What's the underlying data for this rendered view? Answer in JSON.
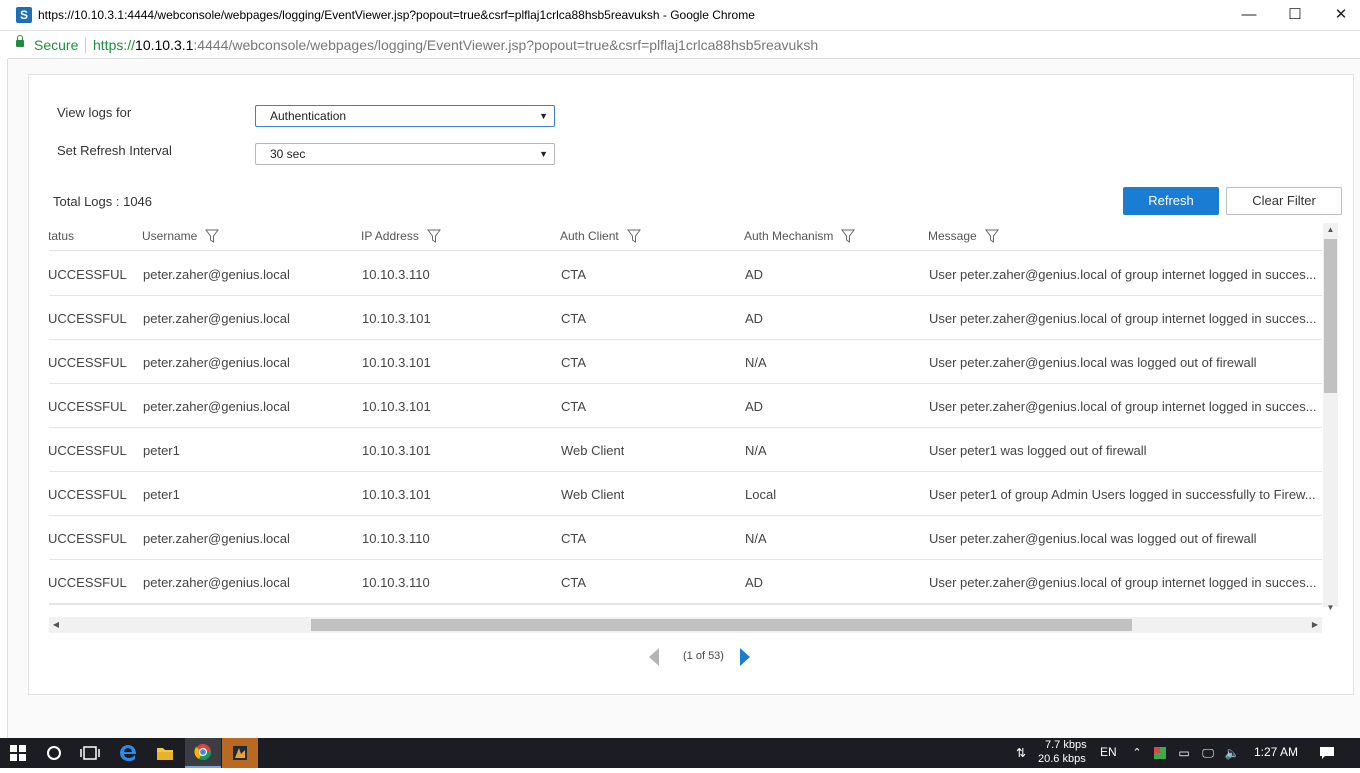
{
  "window": {
    "title": "https://10.10.3.1:4444/webconsole/webpages/logging/EventViewer.jsp?popout=true&csrf=plflaj1crlca88hsb5reavuksh - Google Chrome",
    "favicon_letter": "S",
    "minimize": "—",
    "maximize": "☐",
    "close": "✕"
  },
  "addressbar": {
    "secure_label": "Secure",
    "url_proto": "https://",
    "url_host": "10.10.3.1",
    "url_rest": ":4444/webconsole/webpages/logging/EventViewer.jsp?popout=true&csrf=plflaj1crlca88hsb5reavuksh"
  },
  "form": {
    "view_logs_label": "View logs for",
    "view_logs_value": "Authentication",
    "refresh_interval_label": "Set Refresh Interval",
    "refresh_interval_value": "30 sec"
  },
  "summary": {
    "total_logs": "Total Logs : 1046"
  },
  "buttons": {
    "refresh": "Refresh",
    "clear_filter": "Clear Filter"
  },
  "table": {
    "columns": [
      "tatus",
      "Username",
      "IP Address",
      "Auth Client",
      "Auth Mechanism",
      "Message"
    ],
    "rows": [
      [
        "UCCESSFUL",
        "peter.zaher@genius.local",
        "10.10.3.110",
        "CTA",
        "AD",
        "User peter.zaher@genius.local of group internet logged in succes..."
      ],
      [
        "UCCESSFUL",
        "peter.zaher@genius.local",
        "10.10.3.101",
        "CTA",
        "AD",
        "User peter.zaher@genius.local of group internet logged in succes..."
      ],
      [
        "UCCESSFUL",
        "peter.zaher@genius.local",
        "10.10.3.101",
        "CTA",
        "N/A",
        "User peter.zaher@genius.local was logged out of firewall"
      ],
      [
        "UCCESSFUL",
        "peter.zaher@genius.local",
        "10.10.3.101",
        "CTA",
        "AD",
        "User peter.zaher@genius.local of group internet logged in succes..."
      ],
      [
        "UCCESSFUL",
        "peter1",
        "10.10.3.101",
        "Web Client",
        "N/A",
        "User peter1 was logged out of firewall"
      ],
      [
        "UCCESSFUL",
        "peter1",
        "10.10.3.101",
        "Web Client",
        "Local",
        "User peter1 of group Admin Users logged in successfully to Firew..."
      ],
      [
        "UCCESSFUL",
        "peter.zaher@genius.local",
        "10.10.3.110",
        "CTA",
        "N/A",
        "User peter.zaher@genius.local was logged out of firewall"
      ],
      [
        "UCCESSFUL",
        "peter.zaher@genius.local",
        "10.10.3.110",
        "CTA",
        "AD",
        "User peter.zaher@genius.local of group internet logged in succes..."
      ]
    ]
  },
  "pager": {
    "text": "(1 of 53)"
  },
  "taskbar": {
    "net_down": "7.7 kbps",
    "net_up": "20.6 kbps",
    "lang": "EN",
    "time": "1:27 AM"
  },
  "colors": {
    "accent": "#1b7cd3",
    "secure_green": "#1e8e3e",
    "taskbar": "#1b1d23"
  }
}
